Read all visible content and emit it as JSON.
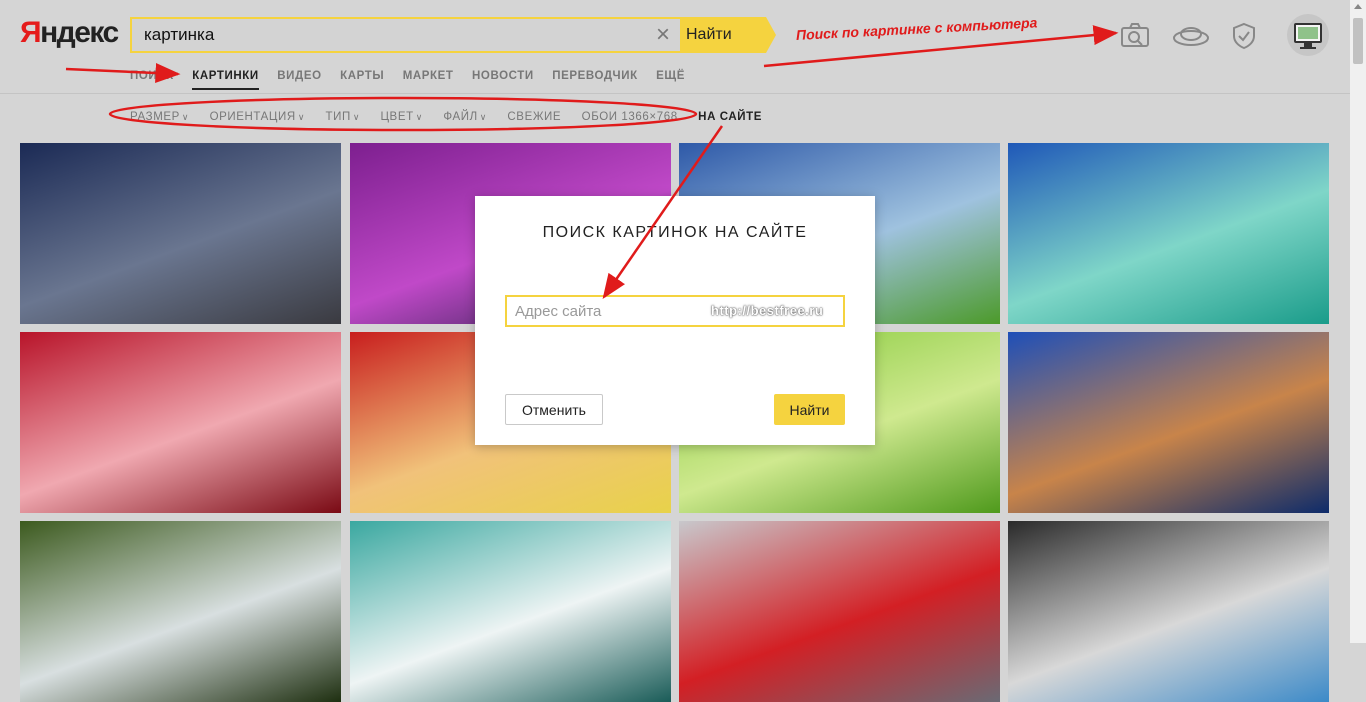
{
  "logo": {
    "first": "Я",
    "rest": "ндекс"
  },
  "search": {
    "value": "картинка",
    "button_label": "Найти"
  },
  "header_icons": [
    "camera-icon",
    "disk-icon",
    "shield-icon"
  ],
  "nav": {
    "items": [
      {
        "label": "Поиск",
        "active": false
      },
      {
        "label": "Картинки",
        "active": true
      },
      {
        "label": "Видео",
        "active": false
      },
      {
        "label": "Карты",
        "active": false
      },
      {
        "label": "Маркет",
        "active": false
      },
      {
        "label": "Новости",
        "active": false
      },
      {
        "label": "Переводчик",
        "active": false
      },
      {
        "label": "Ещё",
        "active": false
      }
    ]
  },
  "filters": {
    "items": [
      {
        "label": "Размер",
        "dropdown": true
      },
      {
        "label": "Ориентация",
        "dropdown": true
      },
      {
        "label": "Тип",
        "dropdown": true
      },
      {
        "label": "Цвет",
        "dropdown": true
      },
      {
        "label": "Файл",
        "dropdown": true
      },
      {
        "label": "Свежие",
        "dropdown": false
      },
      {
        "label": "Обои 1366×768",
        "dropdown": false
      }
    ],
    "on_site_label": "На сайте"
  },
  "annotation": {
    "text": "Поиск по картинке с компьютера",
    "color": "#e01b1b"
  },
  "modal": {
    "title": "Поиск картинок на сайте",
    "input_placeholder": "Адрес сайта",
    "watermark": "http://bestfree.ru",
    "cancel_label": "Отменить",
    "ok_label": "Найти"
  },
  "images": [
    {
      "name": "lake-pier-night",
      "colors": [
        "#1b2a55",
        "#6a7690",
        "#3a3a40"
      ]
    },
    {
      "name": "bridge-purple",
      "colors": [
        "#7d1f8f",
        "#c049c8",
        "#2a1f4a"
      ]
    },
    {
      "name": "mountain-meadow",
      "colors": [
        "#2e59a8",
        "#9fc2df",
        "#4c9a2a"
      ]
    },
    {
      "name": "tropical-bungalows",
      "colors": [
        "#1f58b8",
        "#7fd6c8",
        "#1a9c8a"
      ]
    },
    {
      "name": "strawberry-splash",
      "colors": [
        "#b8142a",
        "#f0a8b0",
        "#7a0a14"
      ]
    },
    {
      "name": "red-flower-drops",
      "colors": [
        "#c81e1e",
        "#f1c27a",
        "#e8d24a"
      ]
    },
    {
      "name": "lime-slices",
      "colors": [
        "#7ec633",
        "#cfe98f",
        "#4f9a1c"
      ]
    },
    {
      "name": "rocky-beach",
      "colors": [
        "#1e4fb8",
        "#c8844a",
        "#0d2b6a"
      ]
    },
    {
      "name": "forest-waterfall",
      "colors": [
        "#3c5a1e",
        "#d8dfe0",
        "#1e2f10"
      ]
    },
    {
      "name": "dandelion-teal",
      "colors": [
        "#3aa8a0",
        "#eef4f4",
        "#1a5c58"
      ]
    },
    {
      "name": "strawberries-splash-2",
      "colors": [
        "#c8c8cc",
        "#d31f24",
        "#6a6a74"
      ]
    },
    {
      "name": "snow-leopard",
      "colors": [
        "#2a2a2a",
        "#d8d8d8",
        "#3c8ac8"
      ]
    }
  ]
}
